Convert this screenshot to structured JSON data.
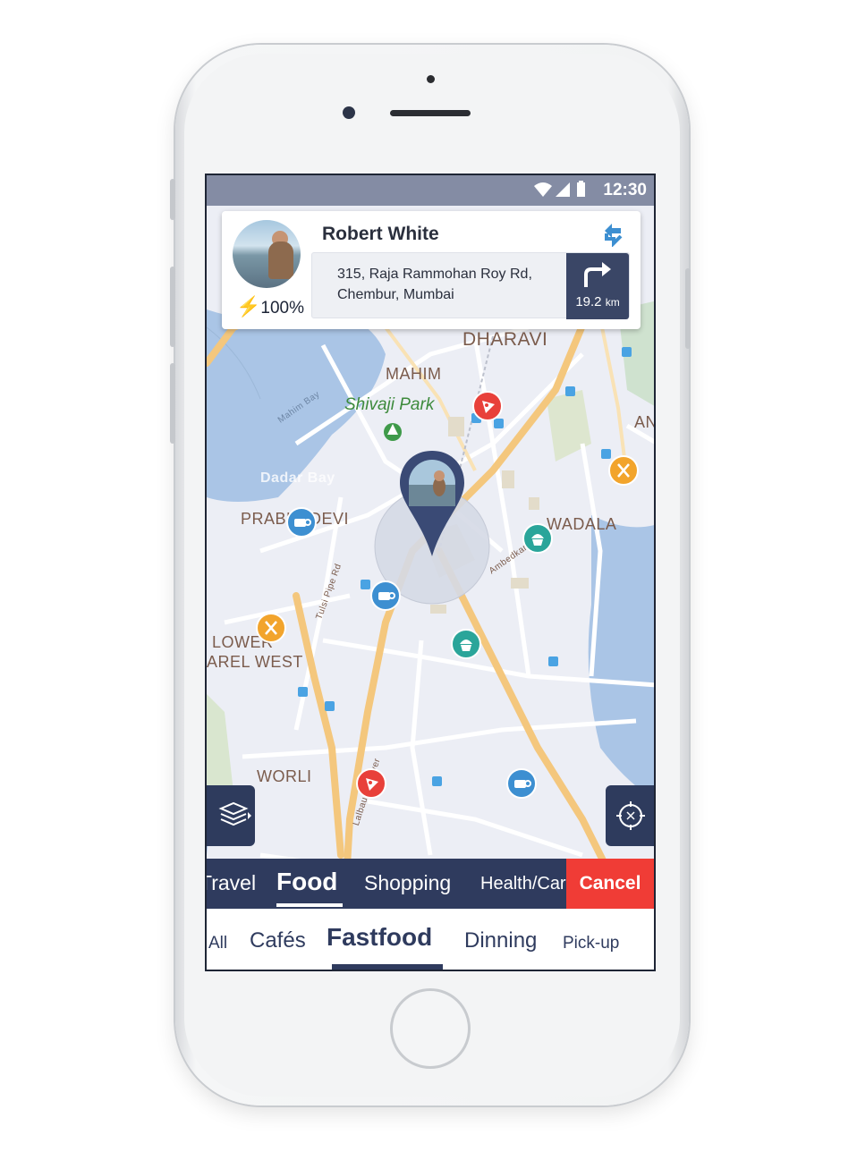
{
  "status_bar": {
    "time": "12:30"
  },
  "profile": {
    "name": "Robert White",
    "battery": "100%",
    "address_line1": "315, Raja Rammohan Roy Rd,",
    "address_line2": "Chembur, Mumbai",
    "distance": "19.2",
    "distance_unit": "km"
  },
  "map_labels": {
    "dharavi": "DHARAVI",
    "mahim": "MAHIM",
    "shivaji_park": "Shivaji Park",
    "prabhadevi": "PRABHADEVI",
    "wadala": "WADALA",
    "lower_parel_1": "LOWER",
    "lower_parel_2": "AREL WEST",
    "worli": "WORLI",
    "an": "AN",
    "dadar_bay": "Dadar Bay",
    "mahim_bay": "Mahim Bay",
    "tulsi_pipe": "Tulsi Pipe Rd",
    "ambedkar": "Ambedkar Marg",
    "lalbaug": "Lalbaug Flyover"
  },
  "categories": [
    "Travel",
    "Food",
    "Shopping",
    "Health/Care"
  ],
  "active_category": "Food",
  "cancel_label": "Cancel",
  "subcategories": [
    "All",
    "Cafés",
    "Fastfood",
    "Dinning",
    "Pick-up"
  ],
  "active_subcategory": "Fastfood",
  "icons": {
    "layers": "layers-icon",
    "locate": "crosshair-icon",
    "swap": "swap-icon",
    "directions": "turn-right-icon"
  },
  "colors": {
    "navy": "#2f3b5e",
    "cancel": "#f03c36",
    "pizza": "#e8403a",
    "cafe": "#3d8fd1",
    "cupcake": "#2aa59a",
    "restaurant": "#f2a42c"
  }
}
